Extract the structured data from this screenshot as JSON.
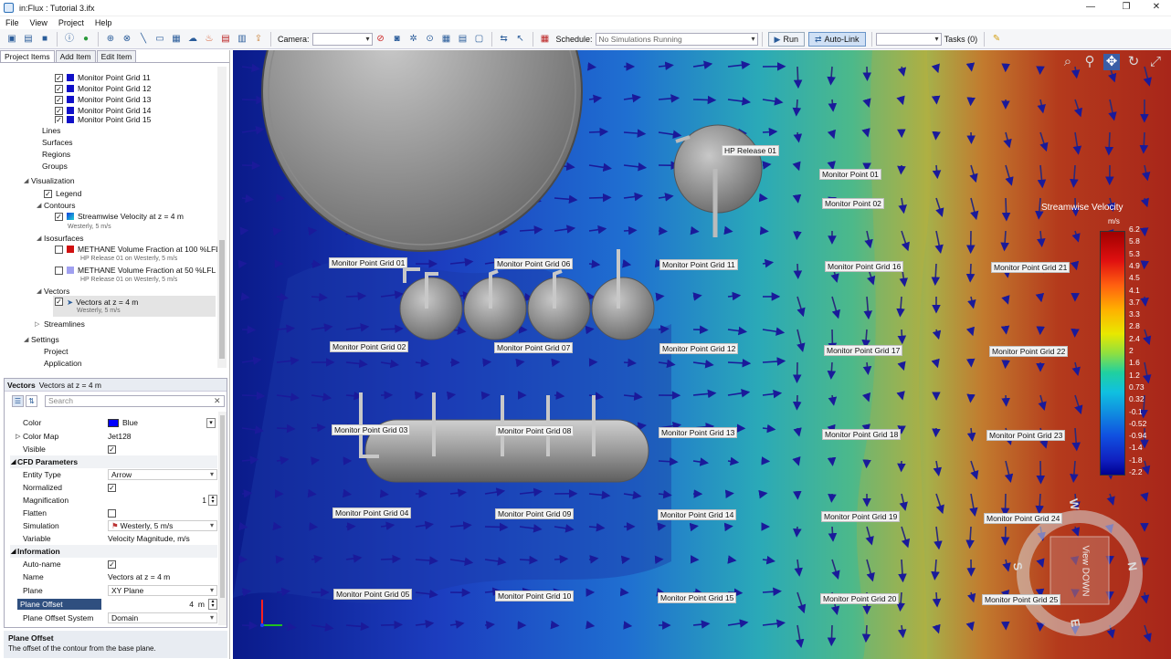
{
  "window": {
    "title": "in:Flux : Tutorial 3.ifx",
    "minimize": "—",
    "restore": "❐",
    "close": "✕"
  },
  "menu": [
    "File",
    "View",
    "Project",
    "Help"
  ],
  "toolbar": {
    "camera_label": "Camera:",
    "camera_value": "",
    "schedule_label": "Schedule:",
    "schedule_value": "No Simulations Running",
    "run_label": "Run",
    "autolink_label": "Auto-Link",
    "tasks_label": "Tasks (0)"
  },
  "tabs": [
    "Project Items",
    "Add Item",
    "Edit Item"
  ],
  "tree": {
    "monitor_grids": [
      "Monitor Point Grid 11",
      "Monitor Point Grid 12",
      "Monitor Point Grid 13",
      "Monitor Point Grid 14",
      "Monitor Point Grid 15"
    ],
    "geometry": [
      "Lines",
      "Surfaces",
      "Regions",
      "Groups"
    ],
    "visualization": "Visualization",
    "legend": "Legend",
    "contours": "Contours",
    "contour_item": "Streamwise Velocity at z = 4 m",
    "contour_sub": "Westerly, 5 m/s",
    "isosurfaces": "Isosurfaces",
    "iso1": "METHANE Volume Fraction at 100 %LFL",
    "iso1_sub": "HP Release 01 on Westerly, 5 m/s",
    "iso2": "METHANE Volume Fraction at 50 %LFL",
    "iso2_sub": "HP Release 01 on Westerly, 5 m/s",
    "vectors": "Vectors",
    "vector_item": "Vectors at z = 4 m",
    "vector_sub": "Westerly, 5 m/s",
    "streamlines": "Streamlines",
    "settings": "Settings",
    "project": "Project",
    "application": "Application"
  },
  "props": {
    "header_type": "Vectors",
    "header_name": "Vectors at z = 4 m",
    "search_placeholder": "Search",
    "rows": {
      "color": "Color",
      "color_val": "Blue",
      "color_map": "Color Map",
      "color_map_val": "Jet128",
      "visible": "Visible",
      "cfd": "CFD Parameters",
      "entity_type": "Entity Type",
      "entity_type_val": "Arrow",
      "normalized": "Normalized",
      "magnification": "Magnification",
      "magnification_val": "1",
      "flatten": "Flatten",
      "simulation": "Simulation",
      "simulation_val": "Westerly, 5 m/s",
      "variable": "Variable",
      "variable_val": "Velocity Magnitude, m/s",
      "information": "Information",
      "auto_name": "Auto-name",
      "name": "Name",
      "name_val": "Vectors at z = 4 m",
      "plane": "Plane",
      "plane_val": "XY Plane",
      "plane_offset": "Plane Offset",
      "plane_offset_val": "4",
      "plane_offset_unit": "m",
      "plane_offset_system": "Plane Offset System",
      "plane_offset_system_val": "Domain"
    },
    "description_title": "Plane Offset",
    "description_text": "The offset of the contour from the base plane."
  },
  "viewport": {
    "labels": [
      "HP Release 01",
      "Monitor Point 01",
      "Monitor Point 02",
      "Monitor Point Grid 01",
      "Monitor Point Grid 06",
      "Monitor Point Grid 11",
      "Monitor Point Grid 16",
      "Monitor Point Grid 21",
      "Monitor Point Grid 02",
      "Monitor Point Grid 07",
      "Monitor Point Grid 12",
      "Monitor Point Grid 17",
      "Monitor Point Grid 22",
      "Monitor Point Grid 03",
      "Monitor Point Grid 08",
      "Monitor Point Grid 13",
      "Monitor Point Grid 18",
      "Monitor Point Grid 23",
      "Monitor Point Grid 04",
      "Monitor Point Grid 09",
      "Monitor Point Grid 14",
      "Monitor Point Grid 19",
      "Monitor Point Grid 24",
      "Monitor Point Grid 05",
      "Monitor Point Grid 10",
      "Monitor Point Grid 15",
      "Monitor Point Grid 20",
      "Monitor Point Grid 25"
    ],
    "legend_title": "Streamwise Velocity",
    "legend_unit": "m/s",
    "legend_ticks": [
      "6.2",
      "5.8",
      "5.3",
      "4.9",
      "4.5",
      "4.1",
      "3.7",
      "3.3",
      "2.8",
      "2.4",
      "2",
      "1.6",
      "1.2",
      "0.73",
      "0.32",
      "-0.1",
      "-0.52",
      "-0.94",
      "-1.4",
      "-1.8",
      "-2.2"
    ],
    "compass": {
      "w": "W",
      "n": "N",
      "s": "S",
      "e": "E",
      "cube": "View DOWN"
    }
  },
  "colors": {
    "blue_swatch": "#0000ff",
    "selected_row": "#2f4f7f"
  }
}
